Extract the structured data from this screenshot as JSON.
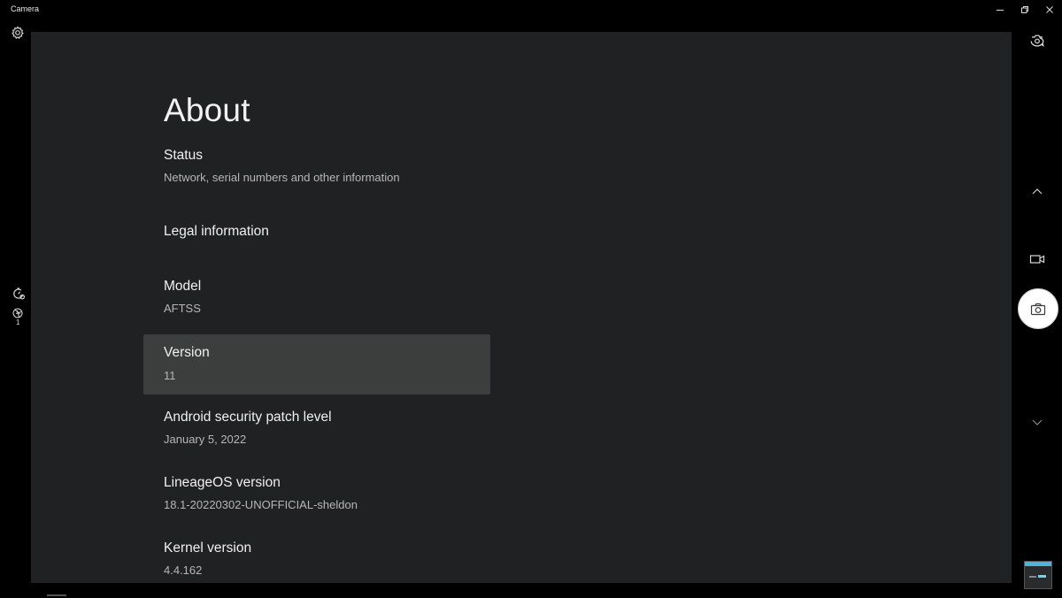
{
  "window": {
    "title": "Camera"
  },
  "about": {
    "title": "About",
    "items": [
      {
        "title": "Status",
        "summary": "Network, serial numbers and other information"
      },
      {
        "title": "Legal information",
        "summary": ""
      },
      {
        "title": "Model",
        "summary": "AFTSS"
      },
      {
        "title": "Version",
        "summary": "11"
      },
      {
        "title": "Android security patch level",
        "summary": "January 5, 2022"
      },
      {
        "title": "LineageOS version",
        "summary": "18.1-20220302-UNOFFICIAL-sheldon"
      },
      {
        "title": "Kernel version",
        "summary": "4.4.162"
      }
    ],
    "selected_index": 3
  },
  "left_controls": {
    "aperture_count": "1"
  },
  "icons": {
    "settings": "gear-icon",
    "timer": "timer-icon",
    "aperture": "aperture-icon",
    "switch_camera": "switch-camera-icon",
    "scroll_up": "chevron-up-icon",
    "video_mode": "video-camera-icon",
    "photo_capture": "camera-icon",
    "scroll_down": "chevron-down-icon"
  },
  "colors": {
    "background": "#000000",
    "viewfinder": "#202122",
    "selected_item": "#3c3e3d",
    "summary_text": "#b6b6b6",
    "accent": "#4fb4d9"
  }
}
